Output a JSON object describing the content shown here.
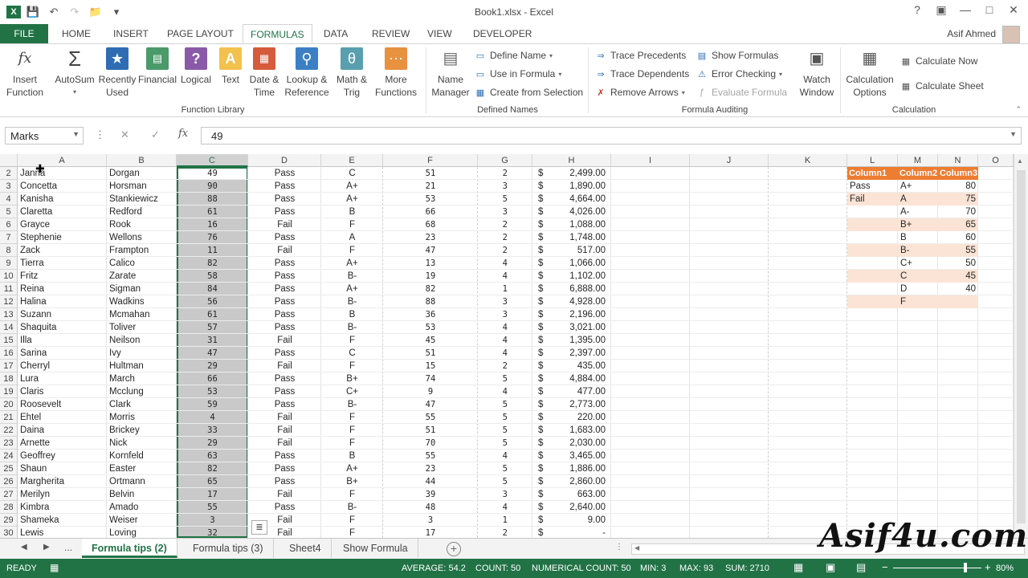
{
  "titlebar": {
    "title": "Book1.xlsx - Excel",
    "qat_icons": [
      "excel-logo-icon",
      "save-icon",
      "undo-icon",
      "redo-icon",
      "open-icon",
      "customize-icon"
    ]
  },
  "tabs": [
    "FILE",
    "HOME",
    "INSERT",
    "PAGE LAYOUT",
    "FORMULAS",
    "DATA",
    "REVIEW",
    "VIEW",
    "DEVELOPER"
  ],
  "active_tab": "FORMULAS",
  "user": {
    "name": "Asif Ahmed"
  },
  "ribbon": {
    "function_library": {
      "label": "Function Library",
      "insert_function": "Insert\nFunction",
      "autosum": "AutoSum",
      "recently_used": "Recently\nUsed",
      "financial": "Financial",
      "logical": "Logical",
      "text": "Text",
      "date_time": "Date &\nTime",
      "lookup_reference": "Lookup &\nReference",
      "math_trig": "Math &\nTrig",
      "more_functions": "More\nFunctions"
    },
    "defined_names": {
      "label": "Defined Names",
      "name_manager": "Name\nManager",
      "define_name": "Define Name",
      "use_in_formula": "Use in Formula",
      "create_from_selection": "Create from Selection"
    },
    "formula_auditing": {
      "label": "Formula Auditing",
      "trace_precedents": "Trace Precedents",
      "trace_dependents": "Trace Dependents",
      "remove_arrows": "Remove Arrows",
      "show_formulas": "Show Formulas",
      "error_checking": "Error Checking",
      "evaluate_formula": "Evaluate Formula",
      "watch_window": "Watch\nWindow"
    },
    "calculation": {
      "label": "Calculation",
      "calculation_options": "Calculation\nOptions",
      "calculate_now": "Calculate Now",
      "calculate_sheet": "Calculate Sheet"
    }
  },
  "formula_bar": {
    "name_box": "Marks",
    "value": "49"
  },
  "columns": [
    "A",
    "B",
    "C",
    "D",
    "E",
    "F",
    "G",
    "H",
    "I",
    "J",
    "K",
    "L",
    "M",
    "N",
    "O"
  ],
  "rows": [
    {
      "n": "2",
      "a": "Janna",
      "b": "Dorgan",
      "c": "49",
      "d": "Pass",
      "e": "C",
      "f": "51",
      "g": "2",
      "h": "2,499.00"
    },
    {
      "n": "3",
      "a": "Concetta",
      "b": "Horsman",
      "c": "90",
      "d": "Pass",
      "e": "A+",
      "f": "21",
      "g": "3",
      "h": "1,890.00"
    },
    {
      "n": "4",
      "a": "Kanisha",
      "b": "Stankiewicz",
      "c": "88",
      "d": "Pass",
      "e": "A+",
      "f": "53",
      "g": "5",
      "h": "4,664.00"
    },
    {
      "n": "5",
      "a": "Claretta",
      "b": "Redford",
      "c": "61",
      "d": "Pass",
      "e": "B",
      "f": "66",
      "g": "3",
      "h": "4,026.00"
    },
    {
      "n": "6",
      "a": "Grayce",
      "b": "Rook",
      "c": "16",
      "d": "Fail",
      "e": "F",
      "f": "68",
      "g": "2",
      "h": "1,088.00"
    },
    {
      "n": "7",
      "a": "Stephenie",
      "b": "Wellons",
      "c": "76",
      "d": "Pass",
      "e": "A",
      "f": "23",
      "g": "2",
      "h": "1,748.00"
    },
    {
      "n": "8",
      "a": "Zack",
      "b": "Frampton",
      "c": "11",
      "d": "Fail",
      "e": "F",
      "f": "47",
      "g": "2",
      "h": "517.00"
    },
    {
      "n": "9",
      "a": "Tierra",
      "b": "Calico",
      "c": "82",
      "d": "Pass",
      "e": "A+",
      "f": "13",
      "g": "4",
      "h": "1,066.00"
    },
    {
      "n": "10",
      "a": "Fritz",
      "b": "Zarate",
      "c": "58",
      "d": "Pass",
      "e": "B-",
      "f": "19",
      "g": "4",
      "h": "1,102.00"
    },
    {
      "n": "11",
      "a": "Reina",
      "b": "Sigman",
      "c": "84",
      "d": "Pass",
      "e": "A+",
      "f": "82",
      "g": "1",
      "h": "6,888.00"
    },
    {
      "n": "12",
      "a": "Halina",
      "b": "Wadkins",
      "c": "56",
      "d": "Pass",
      "e": "B-",
      "f": "88",
      "g": "3",
      "h": "4,928.00"
    },
    {
      "n": "13",
      "a": "Suzann",
      "b": "Mcmahan",
      "c": "61",
      "d": "Pass",
      "e": "B",
      "f": "36",
      "g": "3",
      "h": "2,196.00"
    },
    {
      "n": "14",
      "a": "Shaquita",
      "b": "Toliver",
      "c": "57",
      "d": "Pass",
      "e": "B-",
      "f": "53",
      "g": "4",
      "h": "3,021.00"
    },
    {
      "n": "15",
      "a": "Illa",
      "b": "Neilson",
      "c": "31",
      "d": "Fail",
      "e": "F",
      "f": "45",
      "g": "4",
      "h": "1,395.00"
    },
    {
      "n": "16",
      "a": "Sarina",
      "b": "Ivy",
      "c": "47",
      "d": "Pass",
      "e": "C",
      "f": "51",
      "g": "4",
      "h": "2,397.00"
    },
    {
      "n": "17",
      "a": "Cherryl",
      "b": "Hultman",
      "c": "29",
      "d": "Fail",
      "e": "F",
      "f": "15",
      "g": "2",
      "h": "435.00"
    },
    {
      "n": "18",
      "a": "Lura",
      "b": "March",
      "c": "66",
      "d": "Pass",
      "e": "B+",
      "f": "74",
      "g": "5",
      "h": "4,884.00"
    },
    {
      "n": "19",
      "a": "Claris",
      "b": "Mcclung",
      "c": "53",
      "d": "Pass",
      "e": "C+",
      "f": "9",
      "g": "4",
      "h": "477.00"
    },
    {
      "n": "20",
      "a": "Roosevelt",
      "b": "Clark",
      "c": "59",
      "d": "Pass",
      "e": "B-",
      "f": "47",
      "g": "5",
      "h": "2,773.00"
    },
    {
      "n": "21",
      "a": "Ehtel",
      "b": "Morris",
      "c": "4",
      "d": "Fail",
      "e": "F",
      "f": "55",
      "g": "5",
      "h": "220.00"
    },
    {
      "n": "22",
      "a": "Daina",
      "b": "Brickey",
      "c": "33",
      "d": "Fail",
      "e": "F",
      "f": "51",
      "g": "5",
      "h": "1,683.00"
    },
    {
      "n": "23",
      "a": "Arnette",
      "b": "Nick",
      "c": "29",
      "d": "Fail",
      "e": "F",
      "f": "70",
      "g": "5",
      "h": "2,030.00"
    },
    {
      "n": "24",
      "a": "Geoffrey",
      "b": "Kornfeld",
      "c": "63",
      "d": "Pass",
      "e": "B",
      "f": "55",
      "g": "4",
      "h": "3,465.00"
    },
    {
      "n": "25",
      "a": "Shaun",
      "b": "Easter",
      "c": "82",
      "d": "Pass",
      "e": "A+",
      "f": "23",
      "g": "5",
      "h": "1,886.00"
    },
    {
      "n": "26",
      "a": "Margherita",
      "b": "Ortmann",
      "c": "65",
      "d": "Pass",
      "e": "B+",
      "f": "44",
      "g": "5",
      "h": "2,860.00"
    },
    {
      "n": "27",
      "a": "Merilyn",
      "b": "Belvin",
      "c": "17",
      "d": "Fail",
      "e": "F",
      "f": "39",
      "g": "3",
      "h": "663.00"
    },
    {
      "n": "28",
      "a": "Kimbra",
      "b": "Amado",
      "c": "55",
      "d": "Pass",
      "e": "B-",
      "f": "48",
      "g": "4",
      "h": "2,640.00"
    },
    {
      "n": "29",
      "a": "Shameka",
      "b": "Weiser",
      "c": "3",
      "d": "Fail",
      "e": "F",
      "f": "3",
      "g": "1",
      "h": "9.00"
    },
    {
      "n": "30",
      "a": "Lewis",
      "b": "Loving",
      "c": "32",
      "d": "Fail",
      "e": "F",
      "f": "17",
      "g": "2",
      "h": "-"
    }
  ],
  "currency_symbol": "$",
  "side_table": {
    "headers": [
      "Column1",
      "Column2",
      "Column3"
    ],
    "rows": [
      [
        "Pass",
        "A+",
        "80"
      ],
      [
        "Fail",
        "A",
        "75"
      ],
      [
        "",
        "A-",
        "70"
      ],
      [
        "",
        "B+",
        "65"
      ],
      [
        "",
        "B",
        "60"
      ],
      [
        "",
        "B-",
        "55"
      ],
      [
        "",
        "C+",
        "50"
      ],
      [
        "",
        "C",
        "45"
      ],
      [
        "",
        "D",
        "40"
      ],
      [
        "",
        "F",
        ""
      ]
    ]
  },
  "sheets": [
    "Formula tips (2)",
    "Formula tips (3)",
    "Sheet4",
    "Show Formula"
  ],
  "active_sheet": "Formula tips (2)",
  "sheet_nav_more": "...",
  "status": {
    "ready": "READY",
    "average": "AVERAGE: 54.2",
    "count": "COUNT: 50",
    "numerical_count": "NUMERICAL COUNT: 50",
    "min": "MIN: 3",
    "max": "MAX: 93",
    "sum": "SUM: 2710",
    "zoom": "80%"
  },
  "watermark": "Asif4u.com",
  "colors": {
    "excel_green": "#217346",
    "table_header": "#ed7d31",
    "table_band": "#fbe4d5"
  }
}
